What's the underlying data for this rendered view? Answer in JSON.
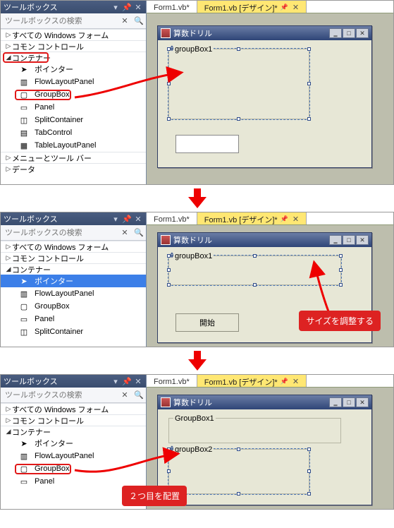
{
  "toolbox": {
    "title": "ツールボックス",
    "search_placeholder": "ツールボックスの検索",
    "categories": {
      "cat0": {
        "label": "すべての Windows フォーム",
        "arrow": "▷"
      },
      "cat1": {
        "label": "コモン コントロール",
        "arrow": "▷"
      },
      "cat2": {
        "label": "コンテナー",
        "arrow": "◢"
      },
      "cat3": {
        "label": "メニューとツール バー",
        "arrow": "▷"
      },
      "cat4": {
        "label": "データ",
        "arrow": "▷"
      }
    },
    "items": {
      "pointer": "ポインター",
      "flow": "FlowLayoutPanel",
      "groupbox": "GroupBox",
      "panel": "Panel",
      "splitcontainer": "SplitContainer",
      "tabcontrol": "TabControl",
      "tablelayout": "TableLayoutPanel"
    }
  },
  "tabs": {
    "inactive": "Form1.vb*",
    "active": "Form1.vb [デザイン]*"
  },
  "form": {
    "title": "算数ドリル",
    "groupbox1": "GroupBox1",
    "groupbox1_drag": "groupBox1",
    "groupbox2_drag": "groupBox2",
    "start_button": "開始"
  },
  "annotations": {
    "resize": "サイズを調整する",
    "place_second": "２つ目を配置"
  }
}
